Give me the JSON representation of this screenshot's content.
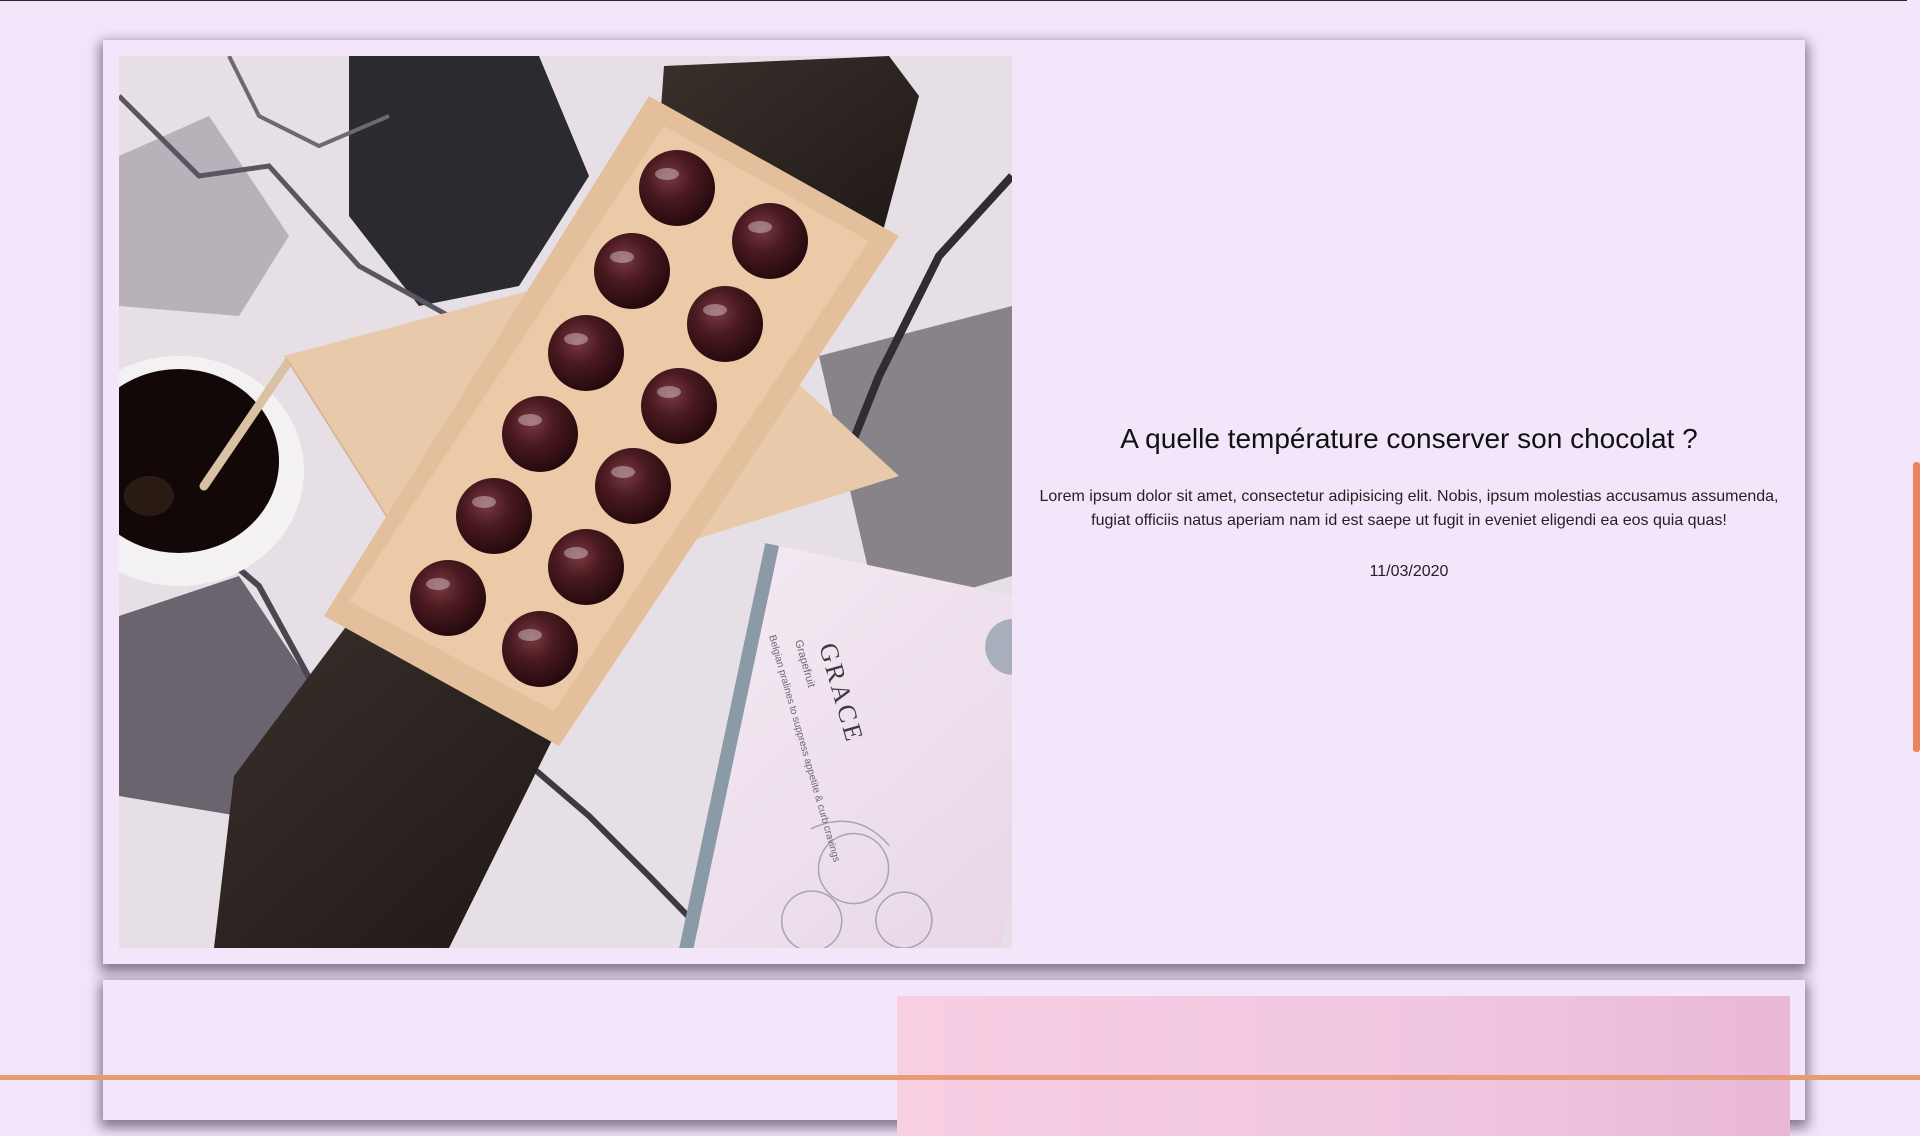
{
  "article": {
    "title": "A quelle température conserver son chocolat ?",
    "excerpt": "Lorem ipsum dolor sit amet, consectetur adipisicing elit. Nobis, ipsum molestias accusamus assumenda, fugiat officiis natus aperiam nam id est saepe ut fugit in eveniet eligendi ea eos quia quas!",
    "date": "11/03/2020",
    "image": {
      "box_label": "GRACE",
      "box_sublabel": "Grapefruit",
      "box_tagline": "Belgian pralines to suppress appetite & curb cravings"
    }
  },
  "colors": {
    "page_background": "#f3e6fb",
    "accent": "#e9855f",
    "chocolate": "#3d1318"
  }
}
